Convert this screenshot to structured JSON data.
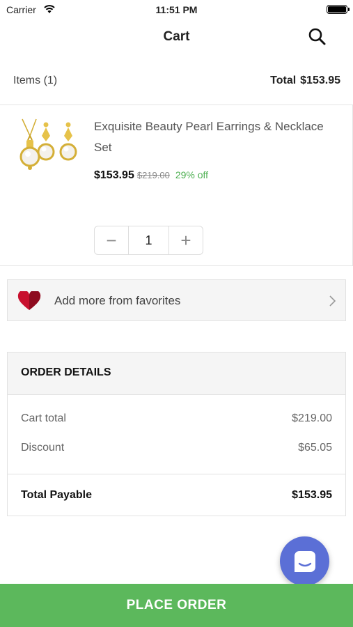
{
  "status_bar": {
    "carrier": "Carrier",
    "time": "11:51 PM"
  },
  "header": {
    "title": "Cart",
    "search_icon": "search-icon"
  },
  "summary": {
    "items_label": "Items (1)",
    "total_label": "Total",
    "total_value": "$153.95"
  },
  "cart_item": {
    "name": "Exquisite Beauty Pearl Earrings & Necklace Set",
    "price": "$153.95",
    "original_price": "$219.00",
    "discount": "29% off",
    "quantity": "1",
    "minus_symbol": "−",
    "plus_symbol": "+"
  },
  "favorites": {
    "label": "Add more from favorites",
    "icon": "heart-icon"
  },
  "order_details": {
    "title": "ORDER DETAILS",
    "rows": [
      {
        "label": "Cart total",
        "value": "$219.00"
      },
      {
        "label": "Discount",
        "value": "$65.05"
      }
    ],
    "payable_label": "Total Payable",
    "payable_value": "$153.95"
  },
  "place_order_label": "PLACE ORDER",
  "colors": {
    "accent_green": "#5cb85c",
    "discount_green": "#4caf50",
    "chat_blue": "#5b6fd6",
    "heart_red": "#c8102e"
  }
}
